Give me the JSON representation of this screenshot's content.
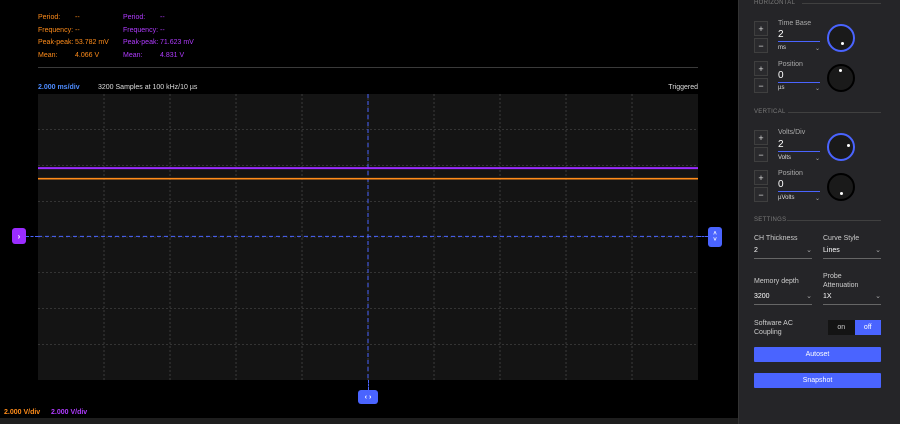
{
  "measurements": {
    "ch1": {
      "color": "#ff8c1a",
      "period": {
        "label": "Period:",
        "value": "--"
      },
      "frequency": {
        "label": "Frequency:",
        "value": "--"
      },
      "peak_peak": {
        "label": "Peak-peak:",
        "value": "53.782 mV"
      },
      "mean": {
        "label": "Mean:",
        "value": "4.066 V"
      }
    },
    "ch2": {
      "color": "#b03bff",
      "period": {
        "label": "Period:",
        "value": "--"
      },
      "frequency": {
        "label": "Frequency:",
        "value": "--"
      },
      "peak_peak": {
        "label": "Peak-peak:",
        "value": "71.623 mV"
      },
      "mean": {
        "label": "Mean:",
        "value": "4.831 V"
      }
    }
  },
  "status": {
    "time_div": "2.000 ms/div",
    "samples": "3200 Samples at 100 kHz/10 µs",
    "trigger": "Triggered"
  },
  "markers": {
    "ch2_marker": "›",
    "trigger_up": "˄",
    "trigger_down": "˅",
    "time_marker": "‹ ›"
  },
  "channel_scales": {
    "ch1": "2.000 V/div",
    "ch2": "2.000 V/div"
  },
  "traces": {
    "ch1_color": "#ff8c1a",
    "ch2_color": "#9b2cff",
    "cursor_color": "#4a64ff",
    "ch1_level_fraction_from_top": 0.296,
    "ch2_level_fraction_from_top": 0.259,
    "trigger_level_fraction_from_top": 0.498,
    "time_cursor_fraction_from_left": 0.5
  },
  "panel": {
    "horizontal": {
      "title": "HORIZONTAL",
      "time_base": {
        "label": "Time Base",
        "value": "2",
        "unit": "ms"
      },
      "position": {
        "label": "Position",
        "value": "0",
        "unit": "µs"
      }
    },
    "vertical": {
      "title": "VERTICAL",
      "volts_div": {
        "label": "Volts/Div",
        "value": "2",
        "unit": "Volts"
      },
      "position": {
        "label": "Position",
        "value": "0",
        "unit": "µVolts"
      }
    },
    "settings": {
      "title": "SETTINGS",
      "ch_thickness": {
        "label": "CH Thickness",
        "value": "2"
      },
      "curve_style": {
        "label": "Curve Style",
        "value": "Lines"
      },
      "memory_depth": {
        "label": "Memory depth",
        "value": "3200"
      },
      "probe_attenuation": {
        "label": "Probe Attenuation",
        "value": "1X"
      },
      "ac_coupling": {
        "label": "Software AC Coupling",
        "on": "on",
        "off": "off"
      }
    },
    "plus": "+",
    "minus": "−",
    "chevron": "⌄",
    "autoset": "Autoset",
    "snapshot": "Snapshot"
  }
}
